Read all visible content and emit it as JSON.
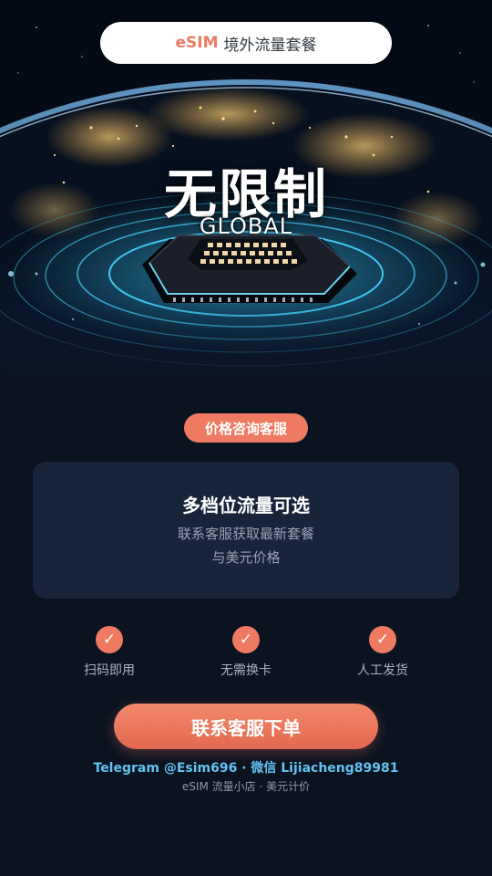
{
  "header": {
    "brand": "eSIM",
    "title": "境外流量套餐"
  },
  "hero": {
    "title": "无限制",
    "subtitle": "GLOBAL"
  },
  "badge": {
    "label": "价格咨询客服"
  },
  "card": {
    "title": "多档位流量可选",
    "line1": "联系客服获取最新套餐",
    "line2": "与美元价格"
  },
  "features": [
    {
      "icon": "check-icon",
      "label": "扫码即用"
    },
    {
      "icon": "check-icon",
      "label": "无需换卡"
    },
    {
      "icon": "check-icon",
      "label": "人工发货"
    }
  ],
  "cta": {
    "label": "联系客服下单"
  },
  "footer": {
    "contact": "Telegram @Esim696 · 微信 Lijiacheng89981",
    "note": "eSIM 流量小店 · 美元计价"
  },
  "colors": {
    "accent": "#ee7a62",
    "background": "#0b1220",
    "card": "#18243a",
    "link": "#63c2f2"
  }
}
